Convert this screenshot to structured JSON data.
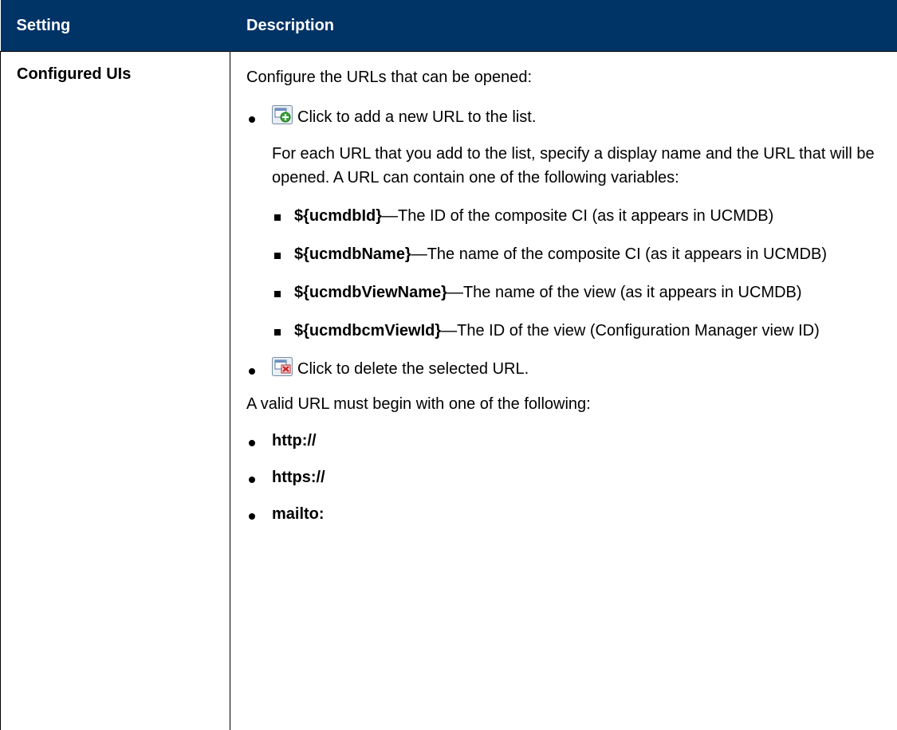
{
  "header": {
    "col1": "Setting",
    "col2": "Description"
  },
  "row": {
    "setting": "Configured UIs",
    "intro": "Configure the URLs that can be opened:",
    "add": {
      "icon": "add-url-icon",
      "text": "Click to add a new URL to the list."
    },
    "add_para": "For each URL that you add to the list, specify a display name and the URL that will be opened. A URL can contain one of the following variables:",
    "variables": [
      {
        "name": "${ucmdbId}",
        "desc": "—The ID of the composite CI (as it appears in UCMDB)"
      },
      {
        "name": "${ucmdbName}",
        "desc": "—The name of the composite CI (as it appears in UCMDB)"
      },
      {
        "name": "${ucmdbViewName}",
        "desc": "—The name of the view (as it appears in UCMDB)"
      },
      {
        "name": "${ucmdbcmViewId}",
        "desc": "—The ID of the view (Configuration Manager view ID)"
      }
    ],
    "delete": {
      "icon": "delete-url-icon",
      "text": "Click to delete the selected URL."
    },
    "valid_intro": "A valid URL must begin with one of the following:",
    "prefixes": [
      "http://",
      "https://",
      "mailto:"
    ]
  }
}
